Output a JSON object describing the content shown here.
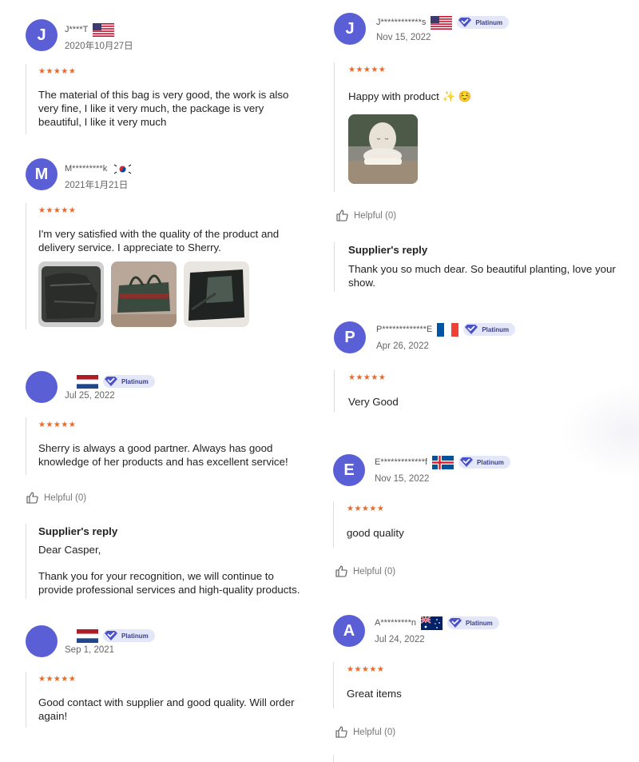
{
  "colors": {
    "avatar": "#5a5fd6",
    "stars": "#e8692a",
    "badge_bg": "#e4e7f8",
    "badge_text": "#3b3f8c"
  },
  "left": [
    {
      "initial": "J",
      "name": "J****T",
      "flag": "us",
      "date": "2020年10月27日",
      "stars": "★★★★★",
      "rating": 5,
      "text": "The material of this bag is very good, the work is also very fine, I like it very much, the package is very beautiful, I like it very much"
    },
    {
      "initial": "M",
      "name": "M*********k",
      "flag": "kr",
      "date": "2021年1月21日",
      "stars": "★★★★★",
      "rating": 5,
      "text": "I'm very satisfied with the quality of the product and delivery service. I appreciate to Sherry.",
      "photos": [
        "bag-photo-1",
        "bag-photo-2",
        "bag-photo-3"
      ]
    },
    {
      "initial": "",
      "name": "",
      "flag": "nl",
      "badge": "Platinum",
      "date": "Jul 25, 2022",
      "stars": "★★★★★",
      "rating": 5,
      "text": "Sherry is always a good partner. Always has good knowledge of her products and has excellent service!",
      "helpful": "Helpful (0)",
      "reply": {
        "title": "Supplier's reply",
        "greeting": "Dear Casper,",
        "text": "Thank you for your recognition, we will continue to provide professional services and high-quality products."
      }
    },
    {
      "initial": "",
      "name": "",
      "flag": "nl",
      "badge": "Platinum",
      "date": "Sep 1, 2021",
      "stars": "★★★★★",
      "rating": 5,
      "text": "Good contact with supplier and good quality. Will order again!"
    }
  ],
  "right": [
    {
      "initial": "J",
      "name": "J************s",
      "flag": "us",
      "badge": "Platinum",
      "date": "Nov 15, 2022",
      "stars": "★★★★★",
      "rating": 5,
      "text": "Happy with product ✨ ☺️",
      "photos": [
        "planter-photo"
      ],
      "helpful": "Helpful (0)",
      "reply": {
        "title": "Supplier's reply",
        "text": "Thank you so much dear. So beautiful planting, love your show."
      }
    },
    {
      "initial": "P",
      "name": "P*************E",
      "flag": "fr",
      "badge": "Platinum",
      "date": "Apr 26, 2022",
      "stars": "★★★★★",
      "rating": 5,
      "text": "Very Good"
    },
    {
      "initial": "E",
      "name": "E*************f",
      "flag": "is",
      "badge": "Platinum",
      "date": "Nov 15, 2022",
      "stars": "★★★★★",
      "rating": 5,
      "text": "good quality",
      "helpful": "Helpful (0)"
    },
    {
      "initial": "A",
      "name": "A*********n",
      "flag": "au",
      "badge": "Platinum",
      "date": "Jul 24, 2022",
      "stars": "★★★★★",
      "rating": 5,
      "text": "Great items",
      "helpful": "Helpful (0)"
    }
  ]
}
